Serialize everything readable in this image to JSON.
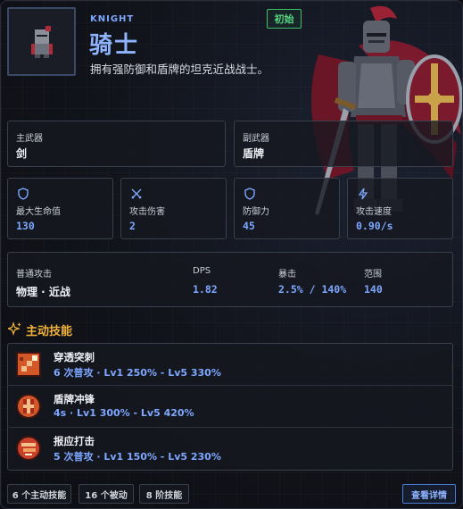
{
  "hero": {
    "name_en": "KNIGHT",
    "name_cn": "骑士",
    "description": "拥有强防御和盾牌的坦克近战战士。",
    "badge": "初始"
  },
  "weapons": {
    "main": {
      "label": "主武器",
      "value": "剑"
    },
    "sub": {
      "label": "副武器",
      "value": "盾牌"
    }
  },
  "stats": [
    {
      "label": "最大生命值",
      "value": "130",
      "icon": "shield-outline-icon"
    },
    {
      "label": "攻击伤害",
      "value": "2",
      "icon": "crossed-swords-icon"
    },
    {
      "label": "防御力",
      "value": "45",
      "icon": "shield-outline-icon"
    },
    {
      "label": "攻击速度",
      "value": "0.90/s",
      "icon": "lightning-icon"
    }
  ],
  "attack": {
    "type_label": "普通攻击",
    "type_value": "物理 · 近战",
    "dps_label": "DPS",
    "dps_value": "1.82",
    "crit_label": "暴击",
    "crit_value": "2.5% / 140%",
    "range_label": "范围",
    "range_value": "140"
  },
  "skills_section": {
    "title": "主动技能",
    "icon": "sparkle-icon"
  },
  "skills": [
    {
      "name": "穿透突刺",
      "info": "6 次普攻 · Lv1 250% - Lv5 330%",
      "icon": "pierce-thrust-icon"
    },
    {
      "name": "盾牌冲锋",
      "info": "4s · Lv1 300% - Lv5 420%",
      "icon": "shield-charge-icon"
    },
    {
      "name": "报应打击",
      "info": "5 次普攻 · Lv1 150% - Lv5 230%",
      "icon": "retribution-strike-icon"
    }
  ],
  "footer": {
    "tags": [
      "6 个主动技能",
      "16 个被动",
      "8 阶技能"
    ],
    "detail_button": "查看详情"
  },
  "colors": {
    "accent": "#7ea7ff",
    "badge": "#54d57f",
    "gold": "#f2b23a"
  }
}
